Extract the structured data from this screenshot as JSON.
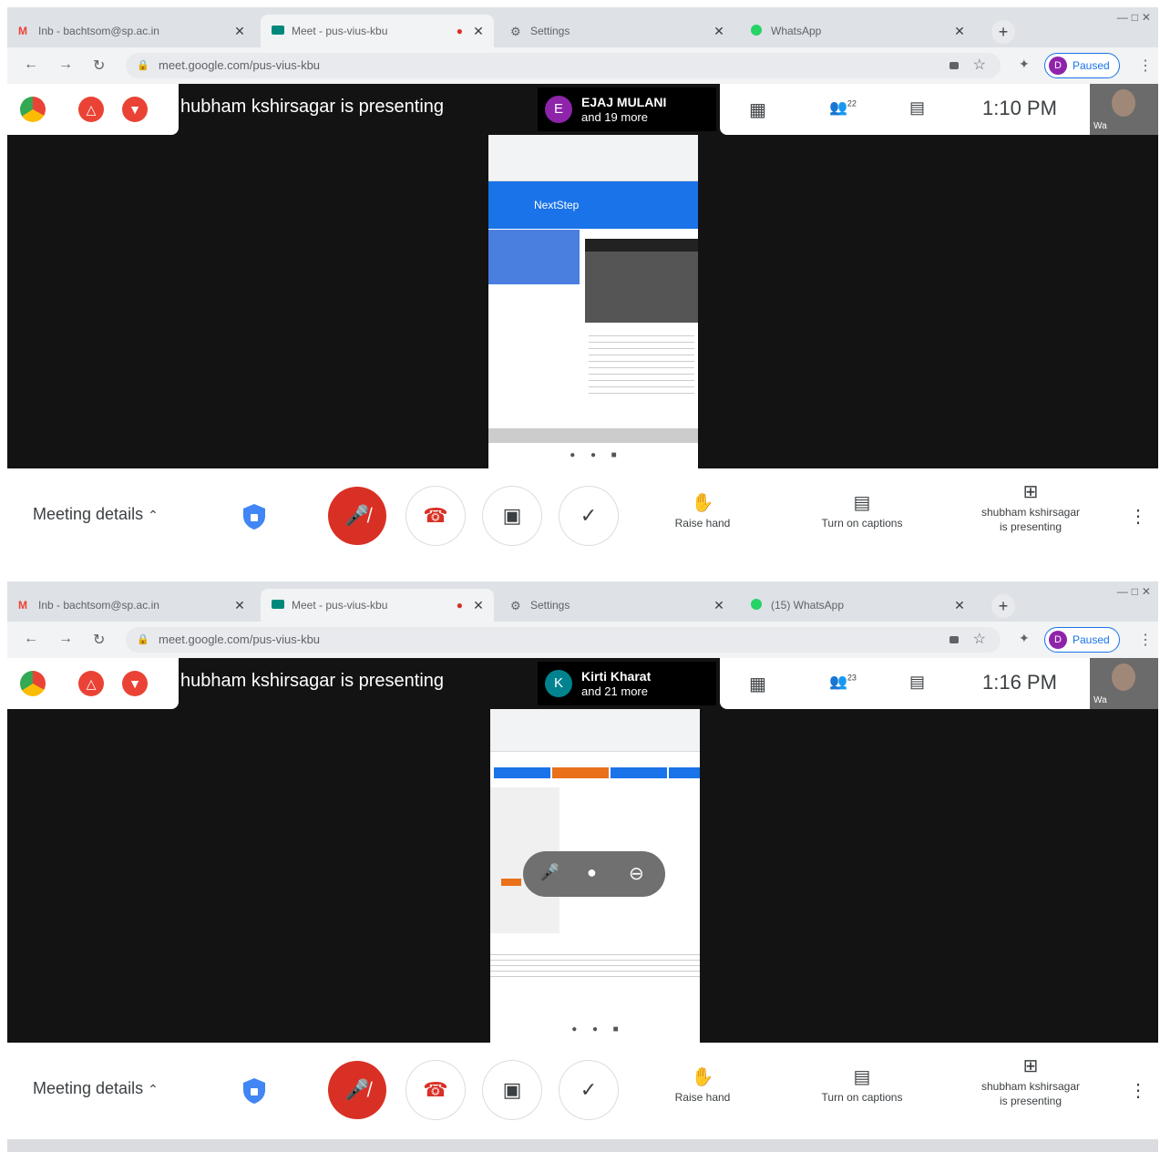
{
  "panels": [
    {
      "tabs": [
        {
          "label": "Inb - bachtsom@sp.ac.in",
          "icon": "gmail-icon",
          "active": false
        },
        {
          "label": "Meet - pus-vius-kbu",
          "icon": "meet-icon",
          "active": true
        },
        {
          "label": "Settings",
          "icon": "gear-icon",
          "active": false
        },
        {
          "label": "WhatsApp",
          "icon": "whatsapp-icon",
          "active": false
        }
      ],
      "url": "meet.google.com/pus-vius-kbu",
      "profile_initial": "D",
      "profile_label": "Paused",
      "presenting_text": "hubham kshirsagar is presenting",
      "participant_initial": "E",
      "participant_color": "#8e24aa",
      "participant_name": "EJAJ MULANI",
      "participant_more": "and 19 more",
      "people_count": "22",
      "time": "1:10  PM",
      "self_name": "Wa",
      "phone_brand": "NextStep",
      "meeting_details": "Meeting details",
      "raise_hand": "Raise hand",
      "captions": "Turn on captions",
      "presenter_line1": "shubham kshirsagar",
      "presenter_line2": "is presenting"
    },
    {
      "tabs": [
        {
          "label": "Inb - bachtsom@sp.ac.in",
          "icon": "gmail-icon",
          "active": false
        },
        {
          "label": "Meet - pus-vius-kbu",
          "icon": "meet-icon",
          "active": true
        },
        {
          "label": "Settings",
          "icon": "gear-icon",
          "active": false
        },
        {
          "label": "(15) WhatsApp",
          "icon": "whatsapp-icon",
          "active": false
        }
      ],
      "url": "meet.google.com/pus-vius-kbu",
      "profile_initial": "D",
      "profile_label": "Paused",
      "presenting_text": "hubham kshirsagar is presenting",
      "participant_initial": "K",
      "participant_color": "#00838f",
      "participant_name": "Kirti Kharat",
      "participant_more": "and 21 more",
      "people_count": "23",
      "time": "1:16  PM",
      "self_name": "Wa",
      "meeting_details": "Meeting details",
      "raise_hand": "Raise hand",
      "captions": "Turn on captions",
      "presenter_line1": "shubham kshirsagar",
      "presenter_line2": "is presenting"
    }
  ],
  "colors": {
    "end_call_red": "#d93025",
    "meet_blue": "#1a73e8",
    "stage_bg": "#131313"
  }
}
